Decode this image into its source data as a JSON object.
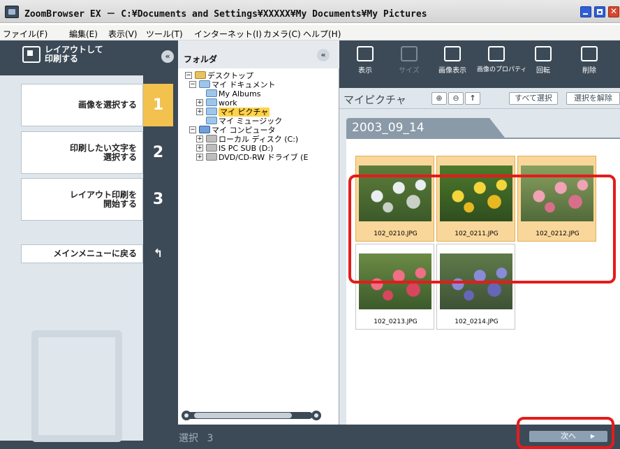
{
  "window": {
    "title": "ZoomBrowser EX － C:¥Documents and Settings¥XXXXX¥My Documents¥My Pictures"
  },
  "menu": [
    "ファイル(F)",
    "編集(E)",
    "表示(V)",
    "ツール(T)",
    "インターネット(I)",
    "カメラ(C)",
    "ヘルプ(H)"
  ],
  "left_panel": {
    "title_line1": "レイアウトして",
    "title_line2": "印刷する",
    "steps": [
      {
        "label_line1": "画像を選択する",
        "label_line2": "",
        "number": "1"
      },
      {
        "label_line1": "印刷したい文字を",
        "label_line2": "選択する",
        "number": "2"
      },
      {
        "label_line1": "レイアウト印刷を",
        "label_line2": "開始する",
        "number": "3"
      }
    ],
    "main_menu_label": "メインメニューに戻る",
    "collapse_glyph": "«"
  },
  "folder_panel": {
    "title": "フォルダ",
    "collapse_glyph": "«",
    "tree": [
      {
        "text": "デスクトップ",
        "toggle": "−",
        "icon": "desktop-icon",
        "selected": false
      },
      {
        "text": "マイ ドキュメント",
        "toggle": "−",
        "icon": "folder-icon",
        "selected": false
      },
      {
        "text": "My Albums",
        "toggle": "",
        "icon": "folder-icon",
        "selected": false
      },
      {
        "text": "work",
        "toggle": "+",
        "icon": "folder-icon",
        "selected": false
      },
      {
        "text": "マイ ピクチャ",
        "toggle": "+",
        "icon": "folder-icon",
        "selected": true
      },
      {
        "text": "マイ ミュージック",
        "toggle": "",
        "icon": "folder-icon",
        "selected": false
      },
      {
        "text": "マイ コンピュータ",
        "toggle": "−",
        "icon": "computer-icon",
        "selected": false
      },
      {
        "text": "ローカル ディスク (C:)",
        "toggle": "+",
        "icon": "drive-icon",
        "selected": false
      },
      {
        "text": "IS PC SUB (D:)",
        "toggle": "+",
        "icon": "drive-icon",
        "selected": false
      },
      {
        "text": "DVD/CD-RW ドライブ (E",
        "toggle": "+",
        "icon": "dvd-drive-icon",
        "selected": false
      }
    ]
  },
  "toolbar": {
    "items": [
      {
        "label": "表示",
        "icon": "view-icon",
        "enabled": true
      },
      {
        "label": "サイズ",
        "icon": "size-icon",
        "enabled": false
      },
      {
        "label": "画像表示",
        "icon": "image-view-icon",
        "enabled": true
      },
      {
        "label": "画像のプロパティ",
        "icon": "image-properties-icon",
        "enabled": true
      },
      {
        "label": "回転",
        "icon": "rotate-icon",
        "enabled": true
      },
      {
        "label": "削除",
        "icon": "delete-icon",
        "enabled": true
      }
    ]
  },
  "browser": {
    "location_title": "マイピクチャ",
    "select_all": "すべて選択",
    "deselect": "選択を解除",
    "group_date": "2003_09_14",
    "thumbnails": [
      {
        "name": "102_0210.JPG",
        "selected": true,
        "palette": [
          "#3b5a2a",
          "#5e7d3a",
          "#e9eef0",
          "#c9d1c6"
        ]
      },
      {
        "name": "102_0211.JPG",
        "selected": true,
        "palette": [
          "#2f4e1f",
          "#4e7a2c",
          "#f4d63c",
          "#e8b820"
        ]
      },
      {
        "name": "102_0212.JPG",
        "selected": true,
        "palette": [
          "#506a3a",
          "#8aa060",
          "#f0a3b5",
          "#d86f8a"
        ]
      },
      {
        "name": "102_0213.JPG",
        "selected": false,
        "palette": [
          "#3b5a2a",
          "#6c8b45",
          "#ef6f86",
          "#d8455f"
        ]
      },
      {
        "name": "102_0214.JPG",
        "selected": false,
        "palette": [
          "#3e5236",
          "#5f7a4a",
          "#8a8bd8",
          "#6566b8"
        ]
      }
    ]
  },
  "bottom": {
    "selection_label": "選択",
    "selection_count": "3",
    "next_label": "次へ"
  },
  "colors": {
    "panel_dark": "#3c4a57",
    "panel_light": "#dfe6ec",
    "step_active": "#f2c14e",
    "selection": "#f9d79a",
    "highlight": "#e51b1b"
  }
}
